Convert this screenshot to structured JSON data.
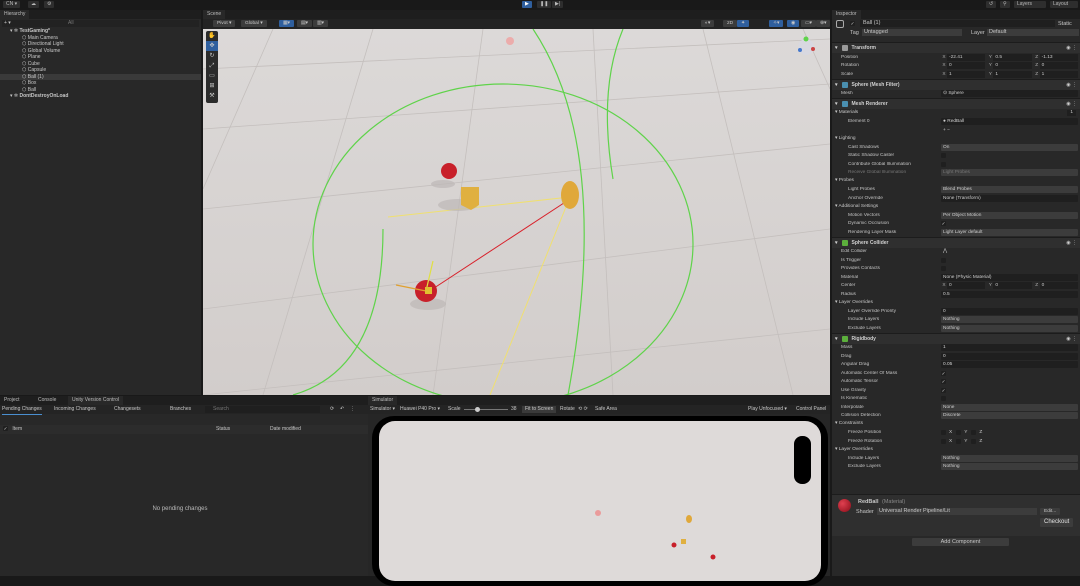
{
  "topbar": {
    "account": "CN ▾",
    "layers": "Layers",
    "layout": "Layout",
    "play_icon": "▶",
    "pause_icon": "❚❚",
    "step_icon": "▶|"
  },
  "hierarchy": {
    "tab": "Hierarchy",
    "search_placeholder": "All",
    "items": [
      {
        "label": "TestGaming*",
        "level": 0,
        "scene": true
      },
      {
        "label": "Main Camera",
        "level": 1
      },
      {
        "label": "Directional Light",
        "level": 1
      },
      {
        "label": "Global Volume",
        "level": 1
      },
      {
        "label": "Plane",
        "level": 1
      },
      {
        "label": "Cube",
        "level": 1
      },
      {
        "label": "Capsule",
        "level": 1
      },
      {
        "label": "Ball (1)",
        "level": 1,
        "selected": true
      },
      {
        "label": "Box",
        "level": 1
      },
      {
        "label": "Ball",
        "level": 1
      },
      {
        "label": "DontDestroyOnLoad",
        "level": 0,
        "scene": true
      }
    ]
  },
  "scene": {
    "tab": "Scene",
    "pivot": "Pivot ▾",
    "global": "Global ▾",
    "tools": [
      "hand",
      "move",
      "rotate",
      "scale",
      "rect",
      "transform",
      "custom"
    ]
  },
  "inspector": {
    "tab": "Inspector",
    "object_name": "Ball (1)",
    "static_label": "Static",
    "tag_label": "Tag",
    "tag_value": "Untagged",
    "layer_label": "Layer",
    "layer_value": "Default",
    "rows": [
      {
        "t": "comp",
        "label": "Transform",
        "color": "#9a9a9a"
      },
      {
        "t": "field",
        "label": "Position",
        "vt": "vec3",
        "v": [
          "-22.41",
          "0.5",
          "-1.13"
        ]
      },
      {
        "t": "field",
        "label": "Rotation",
        "vt": "vec3",
        "v": [
          "0",
          "0",
          "0"
        ]
      },
      {
        "t": "field",
        "label": "Scale",
        "vt": "vec3",
        "v": [
          "1",
          "1",
          "1"
        ]
      },
      {
        "t": "comp",
        "label": "Sphere (Mesh Filter)",
        "color": "#4a8fb0"
      },
      {
        "t": "field",
        "label": "Mesh",
        "vt": "text",
        "v": "⊙ Sphere"
      },
      {
        "t": "comp",
        "label": "Mesh Renderer",
        "color": "#4a8fb0"
      },
      {
        "t": "section",
        "label": "▾ Materials",
        "count": "1"
      },
      {
        "t": "field",
        "label": "Element 0",
        "vt": "text",
        "v": "● RedBall",
        "sub": true
      },
      {
        "t": "field",
        "label": "",
        "vt": "plain",
        "v": "+ −"
      },
      {
        "t": "section",
        "label": "▾ Lighting"
      },
      {
        "t": "field",
        "label": "Cast Shadows",
        "vt": "dropdown",
        "v": "On",
        "sub": true
      },
      {
        "t": "field",
        "label": "Static Shadow Caster",
        "vt": "check",
        "v": false,
        "sub": true
      },
      {
        "t": "field",
        "label": "Contribute Global Illumination",
        "vt": "check",
        "v": false,
        "sub": true
      },
      {
        "t": "field",
        "label": "Receive Global Illumination",
        "vt": "dropdown",
        "v": "Light Probes",
        "sub": true,
        "dim": true
      },
      {
        "t": "section",
        "label": "▾ Probes"
      },
      {
        "t": "field",
        "label": "Light Probes",
        "vt": "dropdown",
        "v": "Blend Probes",
        "sub": true
      },
      {
        "t": "field",
        "label": "Anchor Override",
        "vt": "text",
        "v": "None (Transform)",
        "sub": true
      },
      {
        "t": "section",
        "label": "▾ Additional Settings"
      },
      {
        "t": "field",
        "label": "Motion Vectors",
        "vt": "dropdown",
        "v": "Per Object Motion",
        "sub": true
      },
      {
        "t": "field",
        "label": "Dynamic Occlusion",
        "vt": "check",
        "v": true,
        "sub": true
      },
      {
        "t": "field",
        "label": "Rendering Layer Mask",
        "vt": "dropdown",
        "v": "Light Layer default",
        "sub": true
      },
      {
        "t": "comp",
        "label": "Sphere Collider",
        "color": "#5cb03c"
      },
      {
        "t": "field",
        "label": "Edit Collider",
        "vt": "plain",
        "v": "⋀"
      },
      {
        "t": "field",
        "label": "Is Trigger",
        "vt": "check",
        "v": false
      },
      {
        "t": "field",
        "label": "Provides Contacts",
        "vt": "check",
        "v": false
      },
      {
        "t": "field",
        "label": "Material",
        "vt": "text",
        "v": "None (Physic Material)"
      },
      {
        "t": "field",
        "label": "Center",
        "vt": "vec3",
        "v": [
          "0",
          "0",
          "0"
        ]
      },
      {
        "t": "field",
        "label": "Radius",
        "vt": "text",
        "v": "0.5"
      },
      {
        "t": "section",
        "label": "▾ Layer Overrides"
      },
      {
        "t": "field",
        "label": "Layer Override Priority",
        "vt": "text",
        "v": "0",
        "sub": true
      },
      {
        "t": "field",
        "label": "Include Layers",
        "vt": "dropdown",
        "v": "Nothing",
        "sub": true
      },
      {
        "t": "field",
        "label": "Exclude Layers",
        "vt": "dropdown",
        "v": "Nothing",
        "sub": true
      },
      {
        "t": "comp",
        "label": "Rigidbody",
        "color": "#5cb03c"
      },
      {
        "t": "field",
        "label": "Mass",
        "vt": "text",
        "v": "1"
      },
      {
        "t": "field",
        "label": "Drag",
        "vt": "text",
        "v": "0"
      },
      {
        "t": "field",
        "label": "Angular Drag",
        "vt": "text",
        "v": "0.05"
      },
      {
        "t": "field",
        "label": "Automatic Center Of Mass",
        "vt": "check",
        "v": true
      },
      {
        "t": "field",
        "label": "Automatic Tensor",
        "vt": "check",
        "v": true
      },
      {
        "t": "field",
        "label": "Use Gravity",
        "vt": "check",
        "v": true
      },
      {
        "t": "field",
        "label": "Is Kinematic",
        "vt": "check",
        "v": false
      },
      {
        "t": "field",
        "label": "Interpolate",
        "vt": "dropdown",
        "v": "None"
      },
      {
        "t": "field",
        "label": "Collision Detection",
        "vt": "dropdown",
        "v": "Discrete"
      },
      {
        "t": "section",
        "label": "▾ Constraints"
      },
      {
        "t": "field",
        "label": "Freeze Position",
        "vt": "xyz",
        "v": [
          "X",
          "Y",
          "Z"
        ],
        "sub": true
      },
      {
        "t": "field",
        "label": "Freeze Rotation",
        "vt": "xyz",
        "v": [
          "X",
          "Y",
          "Z"
        ],
        "sub": true
      },
      {
        "t": "section",
        "label": "▾ Layer Overrides"
      },
      {
        "t": "field",
        "label": "Include Layers",
        "vt": "dropdown",
        "v": "Nothing",
        "sub": true
      },
      {
        "t": "field",
        "label": "Exclude Layers",
        "vt": "dropdown",
        "v": "Nothing",
        "sub": true
      }
    ],
    "material": {
      "name": "RedBall",
      "type": "(Material)",
      "shader_label": "Shader",
      "shader": "Universal Render Pipeline/Lit",
      "edit": "Edit...",
      "checkout": "Checkout"
    },
    "add_component": "Add Component"
  },
  "project": {
    "tabs": [
      "Project",
      "Console",
      "Unity Version Control"
    ],
    "subtabs": [
      "Pending Changes",
      "Incoming Changes",
      "Changesets",
      "Branches"
    ],
    "search_placeholder": "Search",
    "columns": [
      "Item",
      "Status",
      "Date modified"
    ],
    "empty": "No pending changes"
  },
  "simulator": {
    "tab": "Simulator",
    "mode": "Simulator ▾",
    "device": "Huawei P40 Pro ▾",
    "scale_label": "Scale",
    "scale_value": "38",
    "scale_fraction": 0.3,
    "fit": "Fit to Screen",
    "rotate": "Rotate",
    "safe_area": "Safe Area",
    "play_mode": "Play Unfocused ▾",
    "control_panel": "Control Panel"
  },
  "colors": {
    "floor": "#d6d2d0",
    "green": "#5fd34a",
    "red": "#c8202a",
    "yellow": "#e0a83a",
    "accent": "#2f5f9e"
  }
}
